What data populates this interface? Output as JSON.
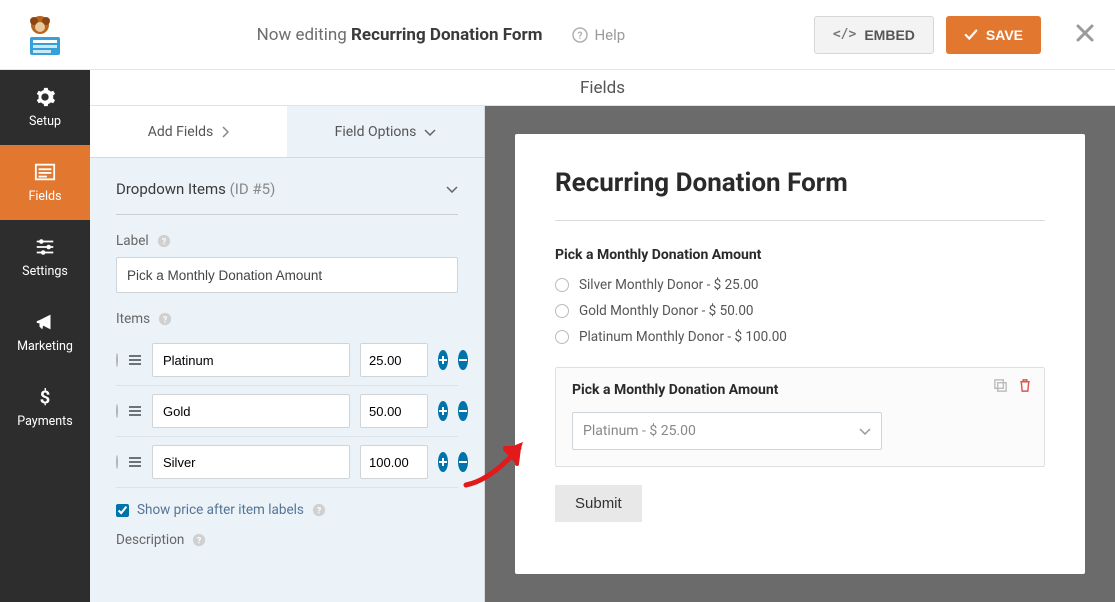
{
  "header": {
    "now_editing": "Now editing",
    "form_name": "Recurring Donation Form",
    "help": "Help",
    "embed": "EMBED",
    "save": "SAVE"
  },
  "sidebar": {
    "items": [
      {
        "label": "Setup"
      },
      {
        "label": "Fields"
      },
      {
        "label": "Settings"
      },
      {
        "label": "Marketing"
      },
      {
        "label": "Payments"
      }
    ]
  },
  "panel": {
    "center_title": "Fields",
    "tabs": {
      "add": "Add Fields",
      "options": "Field Options"
    },
    "section_title": "Dropdown Items",
    "section_id": "(ID #5)",
    "label_label": "Label",
    "label_value": "Pick a Monthly Donation Amount",
    "items_label": "Items",
    "dropdown_items": [
      {
        "name": "Platinum",
        "price": "25.00"
      },
      {
        "name": "Gold",
        "price": "50.00"
      },
      {
        "name": "Silver",
        "price": "100.00"
      }
    ],
    "show_price_label": "Show price after item labels",
    "show_price_checked": true,
    "description_label": "Description"
  },
  "preview": {
    "title": "Recurring Donation Form",
    "field1_label": "Pick a Monthly Donation Amount",
    "radios": [
      "Silver Monthly Donor - $ 25.00",
      "Gold Monthly Donor - $ 50.00",
      "Platinum Monthly Donor - $ 100.00"
    ],
    "field2_label": "Pick a Monthly Donation Amount",
    "dropdown_selected": "Platinum - $ 25.00",
    "submit": "Submit"
  }
}
